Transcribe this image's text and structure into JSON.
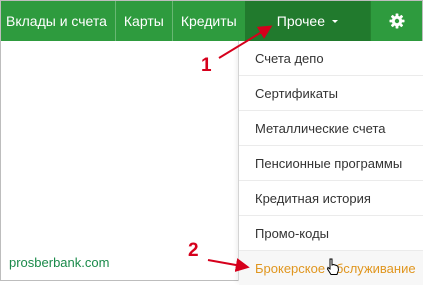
{
  "navbar": {
    "items": [
      {
        "label": "Вклады и счета"
      },
      {
        "label": "Карты"
      },
      {
        "label": "Кредиты"
      },
      {
        "label": "Прочее"
      }
    ],
    "settings_icon": "gear-icon",
    "accent_color": "#2e9b3e",
    "active_color": "#217a2d"
  },
  "dropdown": {
    "items": [
      {
        "label": "Счета депо"
      },
      {
        "label": "Сертификаты"
      },
      {
        "label": "Металлические счета"
      },
      {
        "label": "Пенсионные программы"
      },
      {
        "label": "Кредитная история"
      },
      {
        "label": "Промо-коды"
      },
      {
        "label": "Брокерское обслуживание"
      }
    ],
    "highlight_color": "#e0961f"
  },
  "annotations": {
    "marker_1": "1",
    "marker_2": "2",
    "marker_color": "#d6001c"
  },
  "watermark": "prosberbank.com"
}
